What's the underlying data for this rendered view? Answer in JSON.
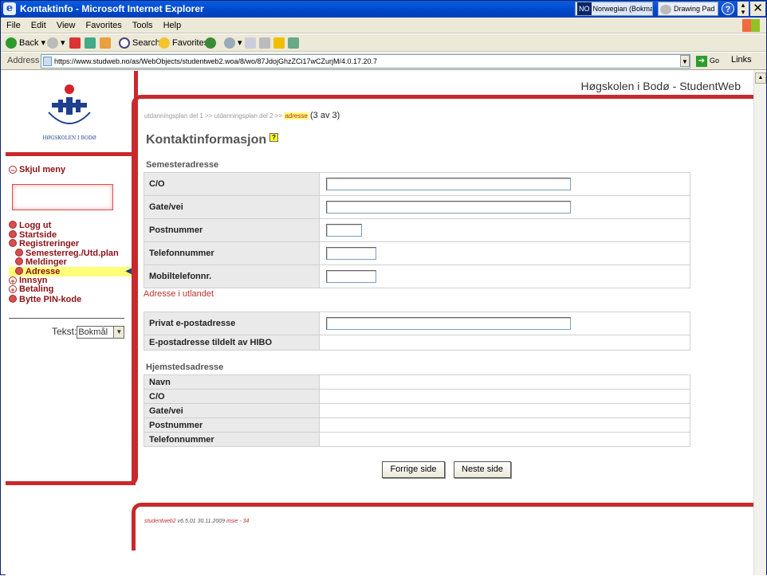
{
  "window": {
    "title": "Kontaktinfo - Microsoft Internet Explorer"
  },
  "taskbar": {
    "lang_code": "NO",
    "lang_label": "Norwegian (Bokmal)",
    "drawing_pad": "Drawing Pad"
  },
  "menu": [
    "File",
    "Edit",
    "View",
    "Favorites",
    "Tools",
    "Help"
  ],
  "toolbar": {
    "back": "Back",
    "search": "Search",
    "favorites": "Favorites"
  },
  "address": {
    "label": "Address",
    "url": "https://www.studweb.no/as/WebObjects/studentweb2.woa/8/wo/87JdojGhzZCi17wCZurjM/4.0.17.20.7",
    "go": "Go",
    "links": "Links"
  },
  "site": {
    "title": "Høgskolen i Bodø - StudentWeb",
    "logo_text": "HØGSKOLEN I BODØ"
  },
  "sidebar": {
    "hide_menu": "Skjul meny",
    "items": [
      {
        "label": "Logg ut",
        "level": 0
      },
      {
        "label": "Startside",
        "level": 0
      },
      {
        "label": "Registreringer",
        "level": 0
      },
      {
        "label": "Semesterreg./Utd.plan",
        "level": 1
      },
      {
        "label": "Meldinger",
        "level": 1
      },
      {
        "label": "Adresse",
        "level": 1,
        "active": true
      },
      {
        "label": "Innsyn",
        "level": 0,
        "plus": true
      },
      {
        "label": "Betaling",
        "level": 0,
        "plus": true
      },
      {
        "label": "Bytte PIN-kode",
        "level": 0
      }
    ],
    "text_label": "Tekst:",
    "language": "Bokmål"
  },
  "breadcrumb": {
    "step1": "utdanningsplan del 1",
    "sep": ">>",
    "step2": "utdanningsplan del 2",
    "current": "adresse",
    "count": "(3 av 3)"
  },
  "heading": "Kontaktinformasjon",
  "help_icon": "?",
  "semester": {
    "title": "Semesteradresse",
    "rows": [
      "C/O",
      "Gate/vei",
      "Postnummer",
      "Telefonnummer",
      "Mobiltelefonnr."
    ]
  },
  "abroad_link": "Adresse i utlandet",
  "email": {
    "private": "Privat e-postadresse",
    "assigned": "E-postadresse tildelt av HIBO"
  },
  "home": {
    "title": "Hjemstedsadresse",
    "rows": [
      "Navn",
      "C/O",
      "Gate/vei",
      "Postnummer",
      "Telefonnummer"
    ]
  },
  "buttons": {
    "prev": "Forrige side",
    "next": "Neste side"
  },
  "footer": {
    "app": "studentweb2",
    "version": "v6.5.01 30.11.2009",
    "server": "insie - 34"
  },
  "colors": {
    "brand_red": "#c9292d",
    "title_bar": "#0047c9",
    "highlight": "#ffff7a"
  }
}
